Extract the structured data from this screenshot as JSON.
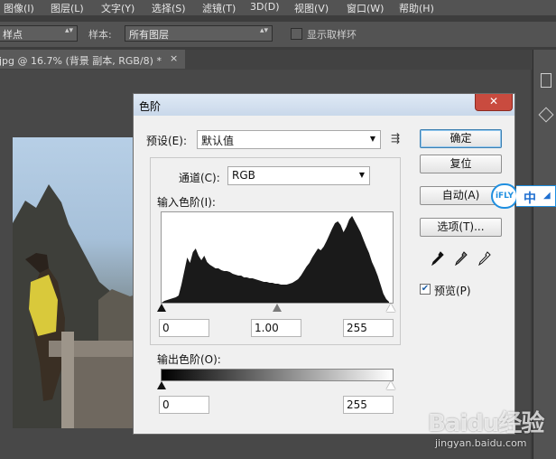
{
  "menu": [
    "图像(I)",
    "图层(L)",
    "文字(Y)",
    "选择(S)",
    "滤镜(T)",
    "3D(D)",
    "视图(V)",
    "窗口(W)",
    "帮助(H)"
  ],
  "options": {
    "sample_size_value": "样点",
    "sample_label": "样本:",
    "sample_value": "所有图层",
    "show_ring_label": "显示取样环"
  },
  "document_tab": {
    "title": "jpg @ 16.7% (背景 副本, RGB/8) *",
    "close": "×"
  },
  "dialog": {
    "title": "色阶",
    "close": "✕",
    "preset_label": "预设(E):",
    "preset_value": "默认值",
    "channel_label": "通道(C):",
    "channel_value": "RGB",
    "input_levels_label": "输入色阶(I):",
    "input_black": "0",
    "input_gamma": "1.00",
    "input_white": "255",
    "output_levels_label": "输出色阶(O):",
    "output_black": "0",
    "output_white": "255",
    "buttons": {
      "ok": "确定",
      "reset": "复位",
      "auto": "自动(A)",
      "options": "选项(T)..."
    },
    "preview_label": "预览(P)",
    "preview_checked": true,
    "histogram": [
      0,
      2,
      3,
      4,
      5,
      6,
      8,
      20,
      35,
      50,
      44,
      56,
      60,
      52,
      47,
      52,
      45,
      42,
      40,
      38,
      38,
      36,
      35,
      35,
      34,
      32,
      31,
      30,
      30,
      28,
      28,
      27,
      27,
      26,
      25,
      24,
      23,
      23,
      22,
      22,
      21,
      21,
      20,
      20,
      20,
      21,
      22,
      24,
      26,
      30,
      35,
      40,
      44,
      50,
      55,
      60,
      58,
      62,
      68,
      75,
      82,
      88,
      90,
      86,
      78,
      84,
      92,
      96,
      90,
      84,
      78,
      70,
      62,
      55,
      45,
      38,
      30,
      20,
      10,
      4,
      1
    ]
  },
  "ime": {
    "brand": "iFLY",
    "mode": "中"
  },
  "watermark": {
    "text": "Baidu经验",
    "url": "jingyan.baidu.com"
  }
}
